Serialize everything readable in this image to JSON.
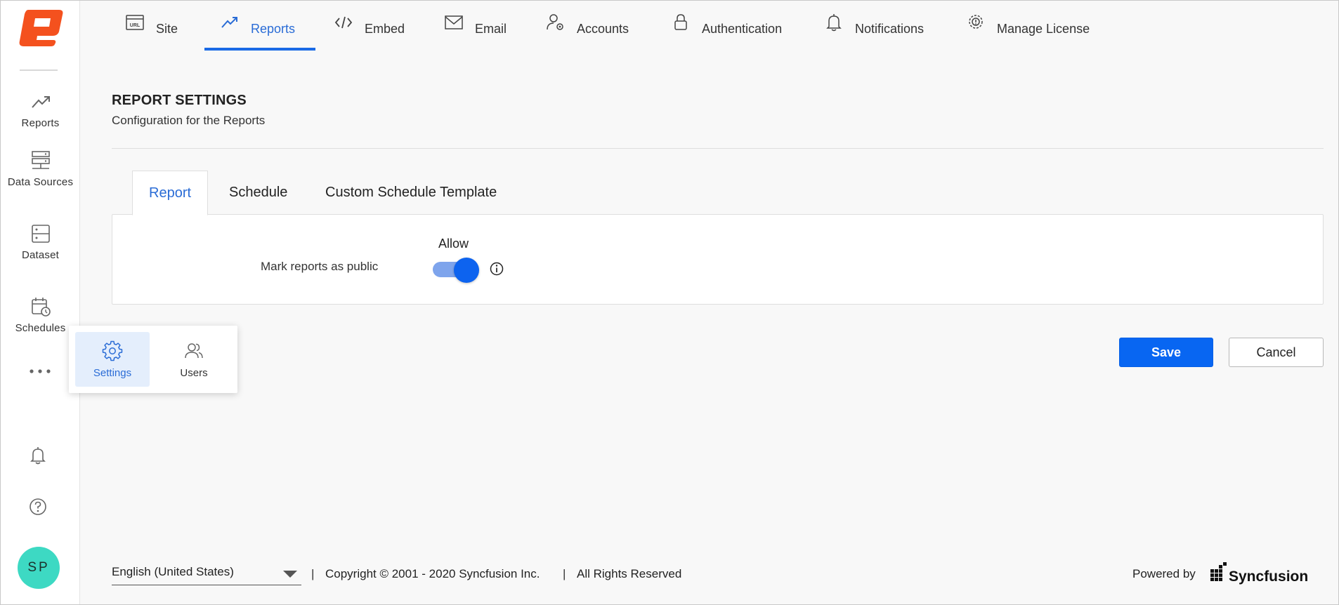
{
  "sidebar": {
    "items": [
      {
        "label": "Reports",
        "icon": "trend-up-icon"
      },
      {
        "label": "Data Sources",
        "icon": "server-icon"
      },
      {
        "label": "Dataset",
        "icon": "dataset-icon"
      },
      {
        "label": "Schedules",
        "icon": "calendar-clock-icon"
      }
    ],
    "avatar_initials": "SP"
  },
  "flyout": {
    "items": [
      {
        "label": "Settings",
        "icon": "gear-icon",
        "active": true
      },
      {
        "label": "Users",
        "icon": "users-icon",
        "active": false
      }
    ]
  },
  "topnav": {
    "tabs": [
      {
        "label": "Site",
        "icon": "url-icon"
      },
      {
        "label": "Reports",
        "icon": "trend-up-icon",
        "active": true
      },
      {
        "label": "Embed",
        "icon": "code-icon"
      },
      {
        "label": "Email",
        "icon": "envelope-icon"
      },
      {
        "label": "Accounts",
        "icon": "user-gear-icon"
      },
      {
        "label": "Authentication",
        "icon": "lock-icon"
      },
      {
        "label": "Notifications",
        "icon": "bell-icon"
      },
      {
        "label": "Manage License",
        "icon": "license-gear-icon"
      }
    ]
  },
  "header": {
    "title": "REPORT SETTINGS",
    "subtitle": "Configuration for the Reports"
  },
  "content_tabs": [
    {
      "label": "Report",
      "active": true
    },
    {
      "label": "Schedule",
      "active": false
    },
    {
      "label": "Custom Schedule Template",
      "active": false
    }
  ],
  "settings": {
    "row_label": "Mark reports as public",
    "column_label": "Allow",
    "toggle_on": true
  },
  "actions": {
    "save_label": "Save",
    "cancel_label": "Cancel"
  },
  "footer": {
    "language": "English (United States)",
    "separator": "|",
    "copyright": "Copyright © 2001 - 2020 Syncfusion Inc.",
    "rights": "All Rights Reserved",
    "powered_by": "Powered by",
    "brand": "Syncfusion"
  },
  "colors": {
    "accent": "#0866f2",
    "logo": "#f4511e",
    "avatar": "#3dd9c3",
    "active_flyout_bg": "#e4eefc"
  }
}
